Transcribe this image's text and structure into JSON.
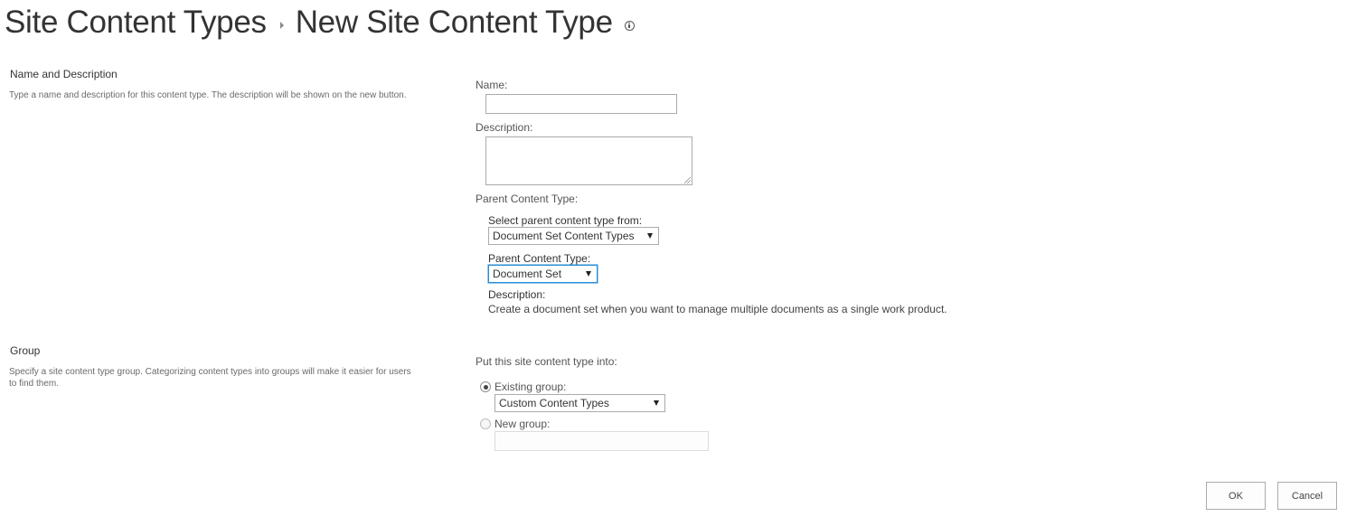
{
  "breadcrumb": {
    "parent": "Site Content Types",
    "current": "New Site Content Type",
    "separator_icon": "chevron-right-icon",
    "info_icon": "info-icon"
  },
  "name_section": {
    "heading": "Name and Description",
    "description": "Type a name and description for this content type. The description will be shown on the new button.",
    "name_label": "Name:",
    "name_value": "",
    "description_label": "Description:",
    "description_value": "",
    "parent_label": "Parent Content Type:",
    "select_from_label": "Select parent content type from:",
    "select_from_value": "Document Set Content Types",
    "parent_type_label": "Parent Content Type:",
    "parent_type_value": "Document Set",
    "parent_desc_label": "Description:",
    "parent_desc_text": "Create a document set when you want to manage multiple documents as a single work product."
  },
  "group_section": {
    "heading": "Group",
    "description_line1": "Specify a site content type group. Categorizing content types into groups will make it easier for users",
    "description_line2": "to find them.",
    "put_into_label": "Put this site content type into:",
    "existing_group_label": "Existing group:",
    "existing_group_checked": true,
    "existing_group_value": "Custom Content Types",
    "new_group_label": "New group:",
    "new_group_checked": false,
    "new_group_value": ""
  },
  "buttons": {
    "ok": "OK",
    "cancel": "Cancel"
  },
  "colors": {
    "focus_border": "#2a8dd4",
    "text": "#444444",
    "title": "#333333"
  }
}
